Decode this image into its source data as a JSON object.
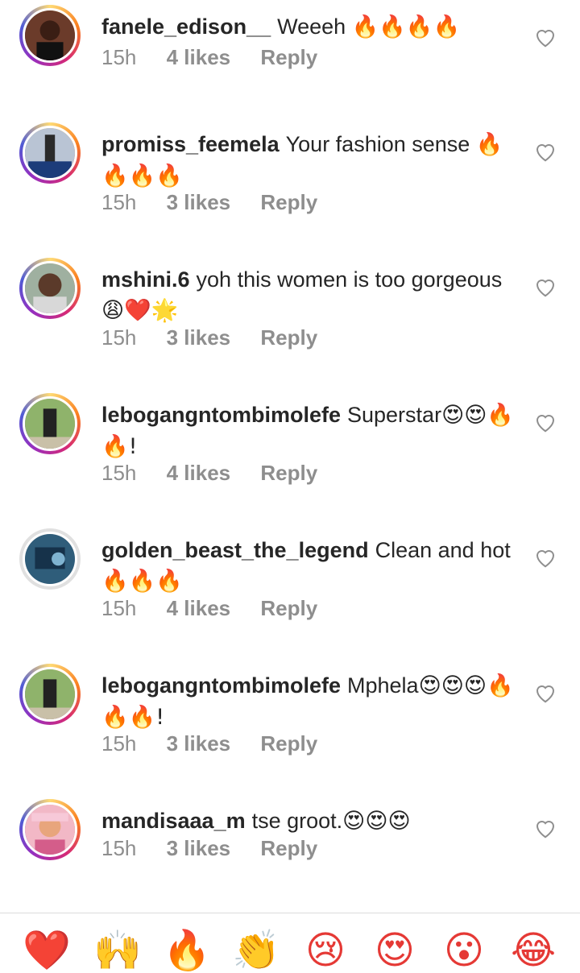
{
  "comments": [
    {
      "username": "fanele_edison__",
      "text": "Weeeh",
      "emoji": "🔥🔥🔥🔥",
      "time": "15h",
      "likes": "4 likes",
      "reply": "Reply"
    },
    {
      "username": "promiss_feemela",
      "text": "Your fashion sense",
      "emoji": "🔥🔥🔥🔥",
      "time": "15h",
      "likes": "3 likes",
      "reply": "Reply"
    },
    {
      "username": "mshini.6",
      "text": "yoh this women is too gorgeous",
      "emoji": "😩❤️🌟",
      "time": "15h",
      "likes": "3 likes",
      "reply": "Reply"
    },
    {
      "username": "lebogangntombimolefe",
      "text": "Superstar",
      "emoji": "😍😍🔥🔥!",
      "time": "15h",
      "likes": "4 likes",
      "reply": "Reply"
    },
    {
      "username": "golden_beast_the_legend",
      "text": "Clean and hot",
      "emoji": "🔥🔥🔥",
      "time": "15h",
      "likes": "4 likes",
      "reply": "Reply"
    },
    {
      "username": "lebogangntombimolefe",
      "text": "Mphela",
      "emoji": "😍😍😍🔥🔥🔥!",
      "time": "15h",
      "likes": "3 likes",
      "reply": "Reply"
    },
    {
      "username": "mandisaaa_m",
      "text": "tse groot.",
      "emoji": "😍😍😍",
      "time": "15h",
      "likes": "3 likes",
      "reply": "Reply"
    }
  ],
  "reactions": [
    "❤️",
    "🙌",
    "🔥",
    "👏",
    "😢",
    "😍",
    "😮",
    "😂"
  ],
  "colors": {
    "ring_start": "#feda75",
    "ring_end": "#962fbf",
    "meta": "#8e8e8e",
    "text": "#262626"
  }
}
